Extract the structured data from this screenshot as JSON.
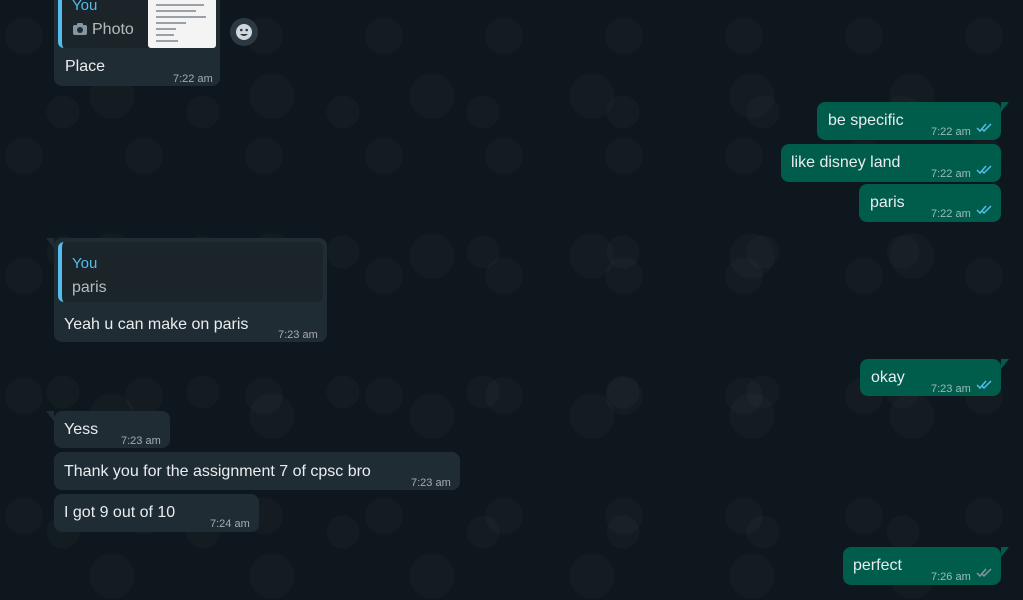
{
  "messages": [
    {
      "id": "m1",
      "direction": "in",
      "reply_to": {
        "name": "You",
        "text": "Photo"
      },
      "text": "Place",
      "time": "7:22 am"
    },
    {
      "id": "m2",
      "direction": "out",
      "text": "be specific",
      "time": "7:22 am"
    },
    {
      "id": "m3",
      "direction": "out",
      "text": "like disney land",
      "time": "7:22 am"
    },
    {
      "id": "m4",
      "direction": "out",
      "text": "paris",
      "time": "7:22 am"
    },
    {
      "id": "m5",
      "direction": "in",
      "reply_to": {
        "name": "You",
        "text": "paris"
      },
      "text": "Yeah u can make on paris",
      "time": "7:23 am"
    },
    {
      "id": "m6",
      "direction": "out",
      "text": "okay",
      "time": "7:23 am"
    },
    {
      "id": "m7",
      "direction": "in",
      "text": "Yess",
      "time": "7:23 am"
    },
    {
      "id": "m8",
      "direction": "in",
      "text": "Thank you for the assignment 7 of cpsc bro",
      "time": "7:23 am"
    },
    {
      "id": "m9",
      "direction": "in",
      "text": "I got 9 out of 10",
      "time": "7:24 am"
    },
    {
      "id": "m10",
      "direction": "out",
      "text": "perfect",
      "time": "7:26 am"
    }
  ],
  "colors": {
    "incoming": "#202c33",
    "outgoing": "#005c4b",
    "read_ticks": "#53bdeb",
    "background": "#0b141a"
  },
  "icons": {
    "photo": "camera-icon",
    "read": "double-check-icon",
    "emoji": "emoji-icon"
  }
}
